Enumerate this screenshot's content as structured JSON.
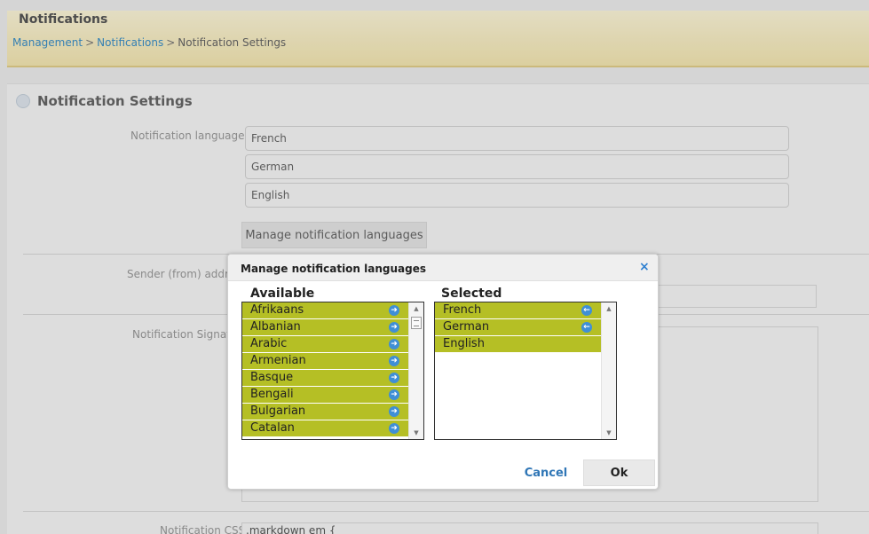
{
  "header": {
    "title": "Notifications",
    "breadcrumb": [
      "Management",
      "Notifications",
      "Notification Settings"
    ],
    "separator": ">"
  },
  "panel": {
    "title": "Notification Settings",
    "labels": {
      "languages": "Notification languages",
      "sender": "Sender (from) addre",
      "signature": "Notification Signatu",
      "css": "Notification CSS"
    },
    "languages": [
      "French",
      "German",
      "English"
    ],
    "manage_button": "Manage notification languages",
    "css_value": ".markdown em {"
  },
  "dialog": {
    "title": "Manage notification languages",
    "close_icon": "×",
    "available_heading": "Available",
    "selected_heading": "Selected",
    "available": [
      "Afrikaans",
      "Albanian",
      "Arabic",
      "Armenian",
      "Basque",
      "Bengali",
      "Bulgarian",
      "Catalan"
    ],
    "selected": [
      "French",
      "German",
      "English"
    ],
    "cancel_label": "Cancel",
    "ok_label": "Ok"
  },
  "colors": {
    "item_bg": "#b5bf25",
    "arrow_bg": "#3f8fd6",
    "link": "#3a8fc8"
  },
  "icons": {
    "add": "arrow-right-icon",
    "remove": "arrow-left-icon"
  }
}
